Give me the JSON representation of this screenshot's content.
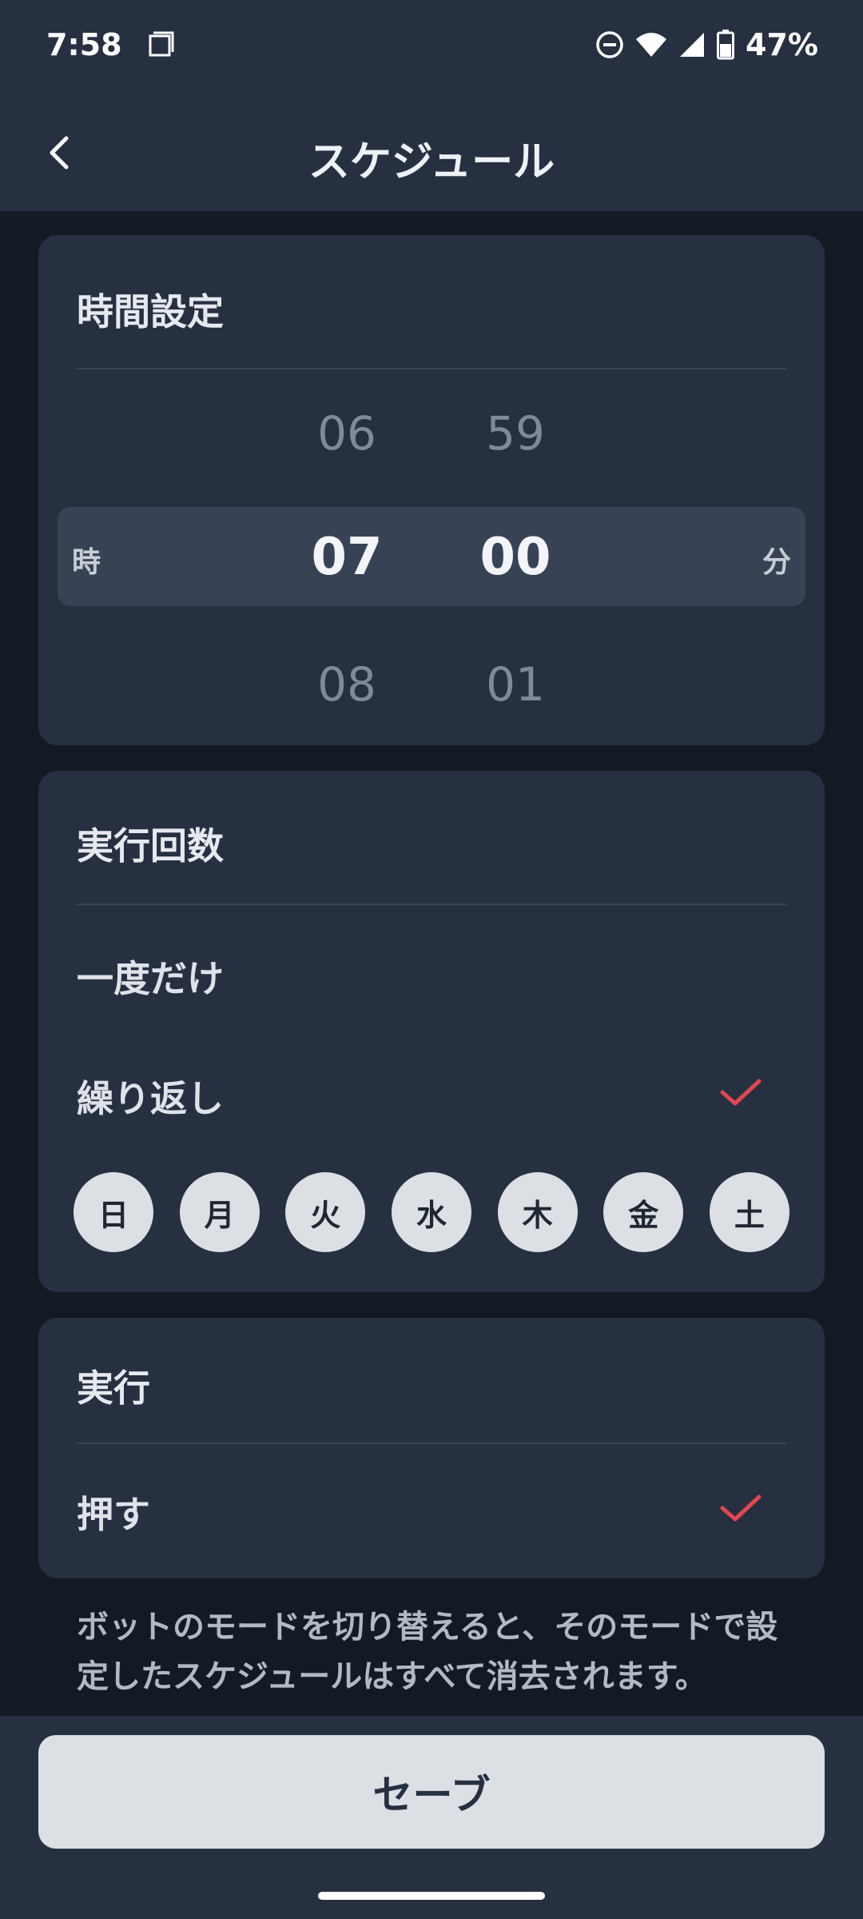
{
  "status_bar": {
    "time": "7:58",
    "battery": "47%",
    "icons": [
      "screenshot-icon",
      "dnd-icon",
      "wifi-icon",
      "signal-icon",
      "battery-icon"
    ]
  },
  "app_bar": {
    "title": "スケジュール",
    "back_icon": "chevron-left-icon"
  },
  "time_setting": {
    "title": "時間設定",
    "hour_unit": "時",
    "minute_unit": "分",
    "hour_prev": "06",
    "hour_selected": "07",
    "hour_next": "08",
    "minute_prev": "59",
    "minute_selected": "00",
    "minute_next": "01"
  },
  "run_count": {
    "title": "実行回数",
    "once_label": "一度だけ",
    "repeat_label": "繰り返し",
    "days": [
      "日",
      "月",
      "火",
      "水",
      "木",
      "金",
      "土"
    ]
  },
  "action": {
    "title": "実行",
    "press_label": "押す"
  },
  "note": "ボットのモードを切り替えると、そのモードで設定したスケジュールはすべて消去されます。",
  "save_label": "セーブ",
  "colors": {
    "background": "#141a24",
    "card": "#263040",
    "check_red": "#e0474f",
    "button": "#dcdfe4"
  }
}
